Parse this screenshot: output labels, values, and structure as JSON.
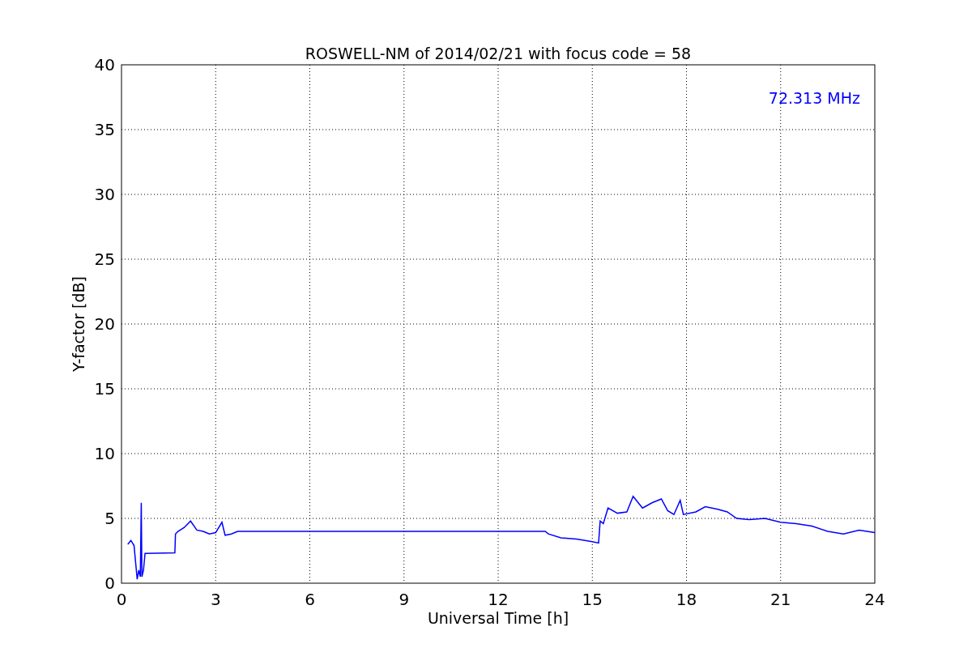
{
  "chart": {
    "chart_data": {
      "type": "line",
      "title": "ROSWELL-NM of 2014/02/21 with focus code = 58",
      "xlabel": "Universal Time [h]",
      "ylabel": "Y-factor [dB]",
      "x": [
        0.2,
        0.3,
        0.4,
        0.5,
        0.55,
        0.6,
        0.63,
        0.65,
        0.7,
        0.75,
        1.7,
        1.72,
        1.8,
        2.0,
        2.2,
        2.4,
        2.6,
        2.8,
        3.0,
        3.2,
        3.3,
        3.5,
        3.7,
        13.5,
        13.6,
        14.0,
        14.5,
        15.0,
        15.2,
        15.25,
        15.35,
        15.5,
        15.8,
        16.1,
        16.3,
        16.6,
        16.9,
        17.2,
        17.4,
        17.6,
        17.8,
        17.9,
        18.3,
        18.6,
        19.0,
        19.3,
        19.6,
        20.0,
        20.5,
        21.0,
        21.5,
        22.0,
        22.5,
        23.0,
        23.5,
        24.0
      ],
      "series": [
        {
          "name": "72.313 MHz",
          "color": "#0000ff",
          "values": [
            3.0,
            3.3,
            2.9,
            0.3,
            1.0,
            0.5,
            6.2,
            0.5,
            1.0,
            2.3,
            2.35,
            3.8,
            4.0,
            4.3,
            4.8,
            4.1,
            4.0,
            3.8,
            3.9,
            4.7,
            3.7,
            3.8,
            4.0,
            4.0,
            3.8,
            3.5,
            3.4,
            3.2,
            3.1,
            4.8,
            4.6,
            5.8,
            5.4,
            5.5,
            6.7,
            5.8,
            6.2,
            6.5,
            5.6,
            5.3,
            6.4,
            5.3,
            5.5,
            5.9,
            5.7,
            5.5,
            5.0,
            4.9,
            5.0,
            4.7,
            4.6,
            4.4,
            4.0,
            3.8,
            4.1,
            3.9
          ]
        }
      ],
      "xlim": [
        0,
        24
      ],
      "ylim": [
        0,
        40
      ],
      "xticks": [
        0,
        3,
        6,
        9,
        12,
        15,
        18,
        21,
        24
      ],
      "yticks": [
        0,
        5,
        10,
        15,
        20,
        25,
        30,
        35,
        40
      ],
      "grid": true
    }
  }
}
